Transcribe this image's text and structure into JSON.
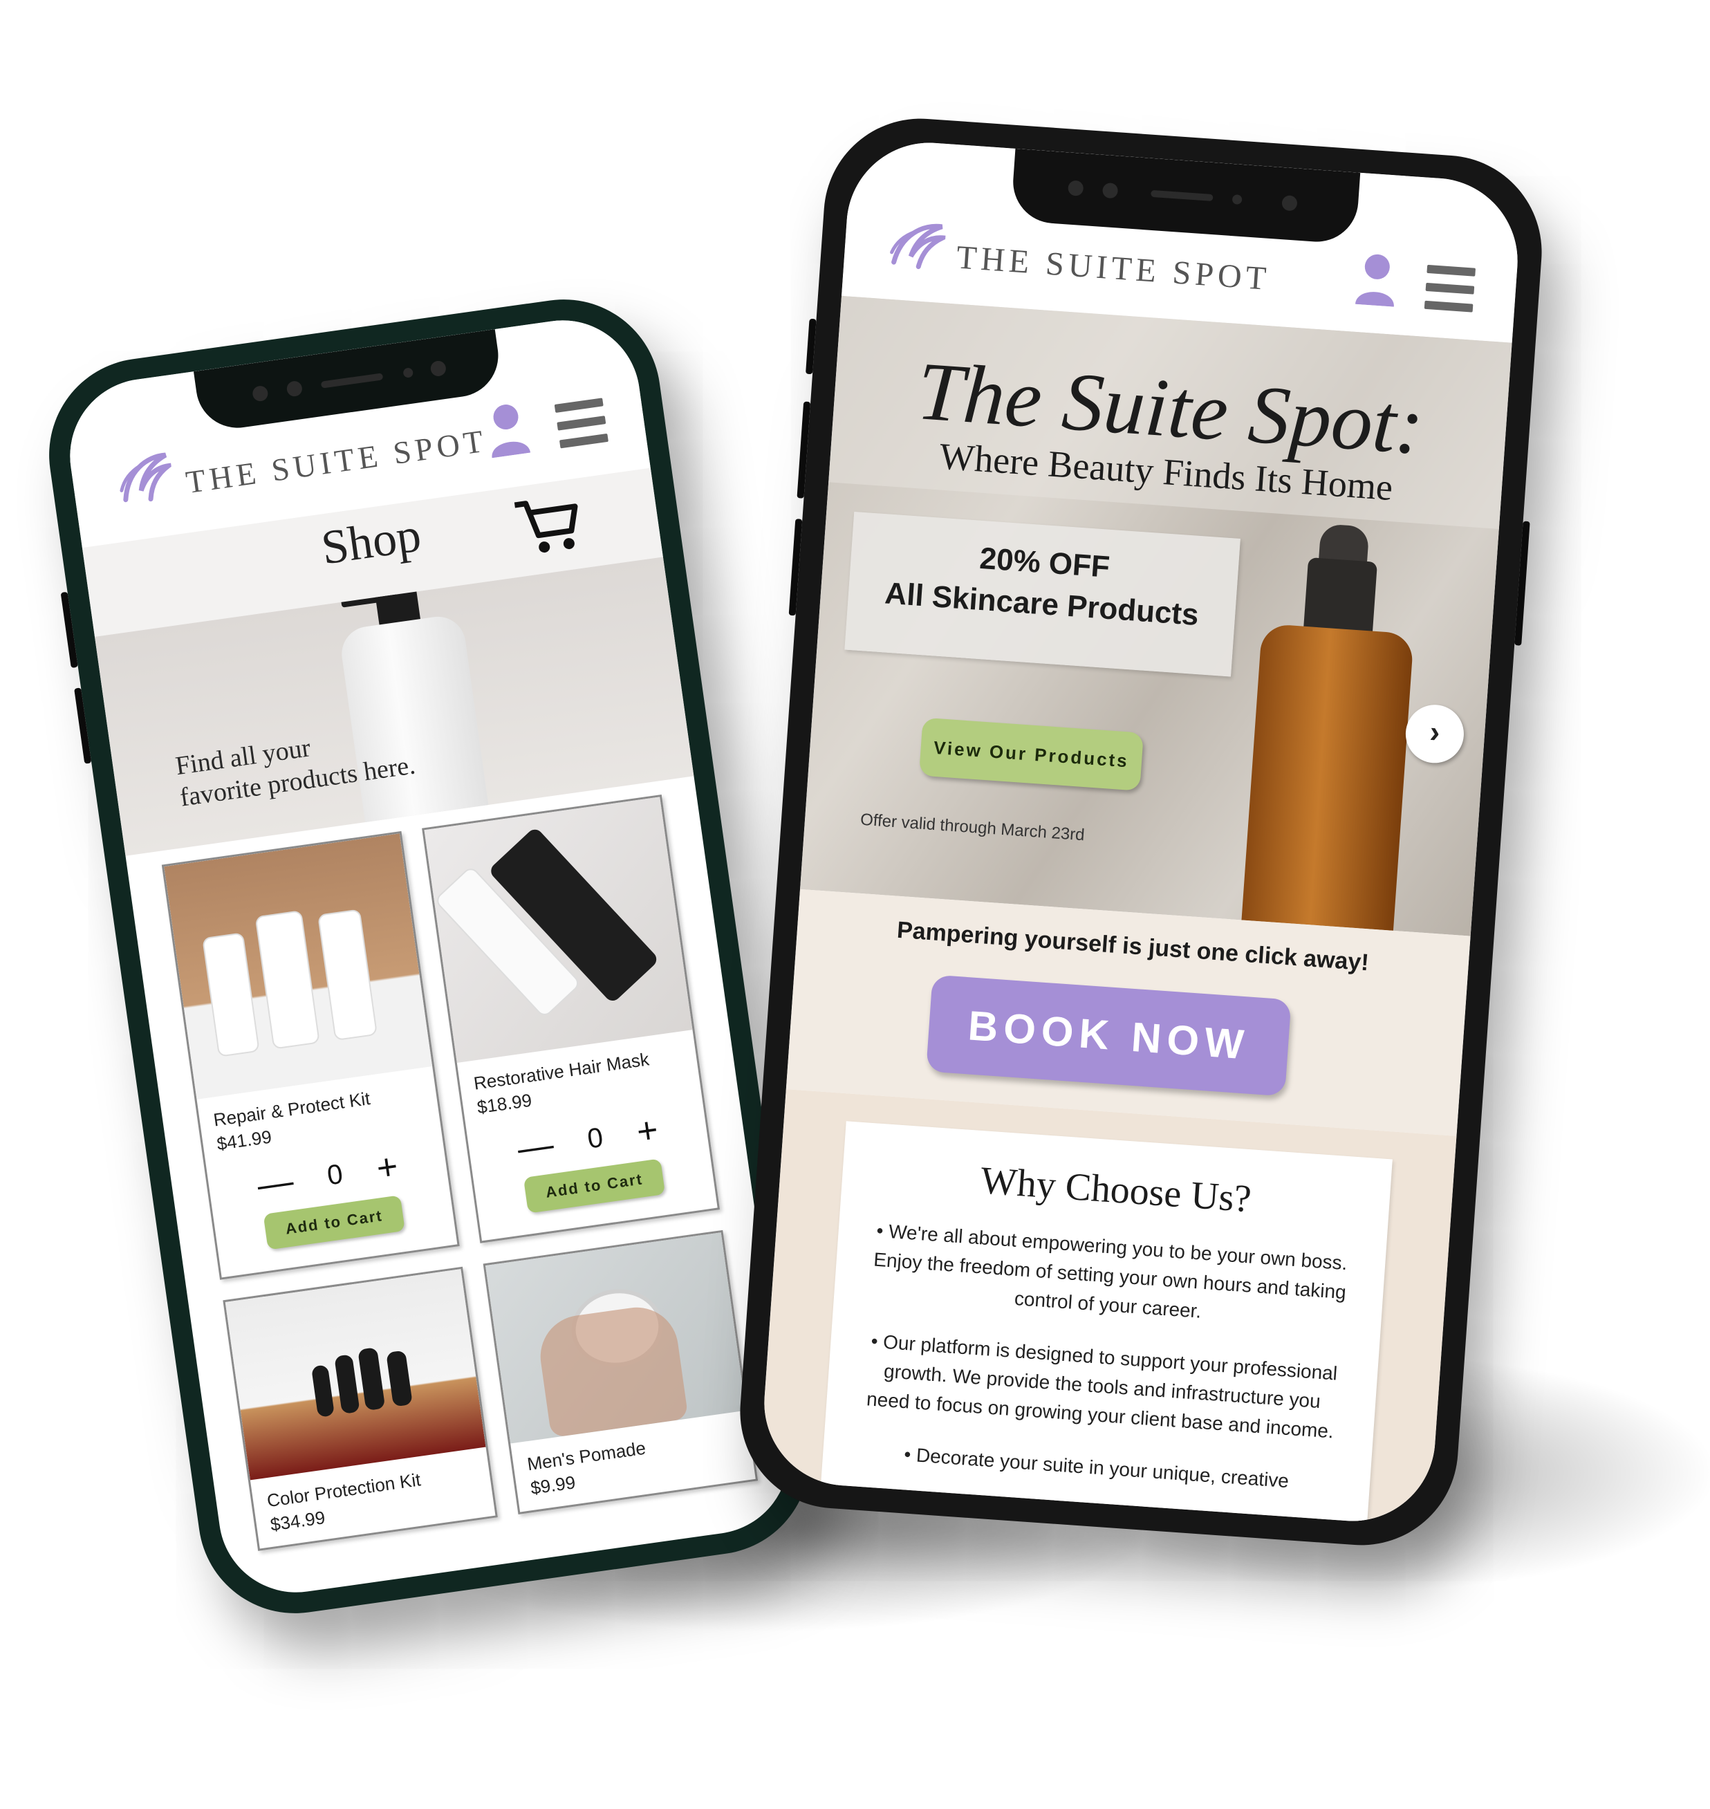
{
  "brand": {
    "name": "THE SUITE SPOT",
    "accent_color": "#a58fd6",
    "icons": [
      "logo-hair-swirl-icon",
      "user-icon",
      "hamburger-menu-icon",
      "cart-icon",
      "chevron-right-icon"
    ]
  },
  "shop_screen": {
    "title": "Shop",
    "hero_text_line1": "Find all your",
    "hero_text_line2": "favorite products here.",
    "products": [
      {
        "name": "Repair & Protect Kit",
        "price": "$41.99",
        "quantity": "0",
        "add_label": "Add to Cart"
      },
      {
        "name": "Restorative Hair Mask",
        "price": "$18.99",
        "quantity": "0",
        "add_label": "Add to Cart"
      },
      {
        "name": "Color Protection Kit",
        "price": "$34.99"
      },
      {
        "name": "Men's Pomade",
        "price": "$9.99"
      }
    ],
    "minus_symbol": "—",
    "plus_symbol": "+"
  },
  "home_screen": {
    "script_title": "The Suite Spot:",
    "subtitle": "Where Beauty Finds Its Home",
    "promo": {
      "line1": "20% OFF",
      "line2": "All Skincare Products",
      "button": "View Our Products",
      "validity": "Offer valid through March 23rd",
      "button_color": "#b3cd7f"
    },
    "cta_text": "Pampering yourself is just one click away!",
    "book_button": "BOOK NOW",
    "why": {
      "title": "Why Choose Us?",
      "items": [
        "• We're all about empowering you to be your own boss. Enjoy the freedom of setting your own hours and taking control of your career.",
        "• Our platform is designed to support your professional growth. We provide the tools and infrastructure you need to focus on growing your client base and income.",
        "• Decorate your suite in your unique, creative"
      ]
    }
  }
}
